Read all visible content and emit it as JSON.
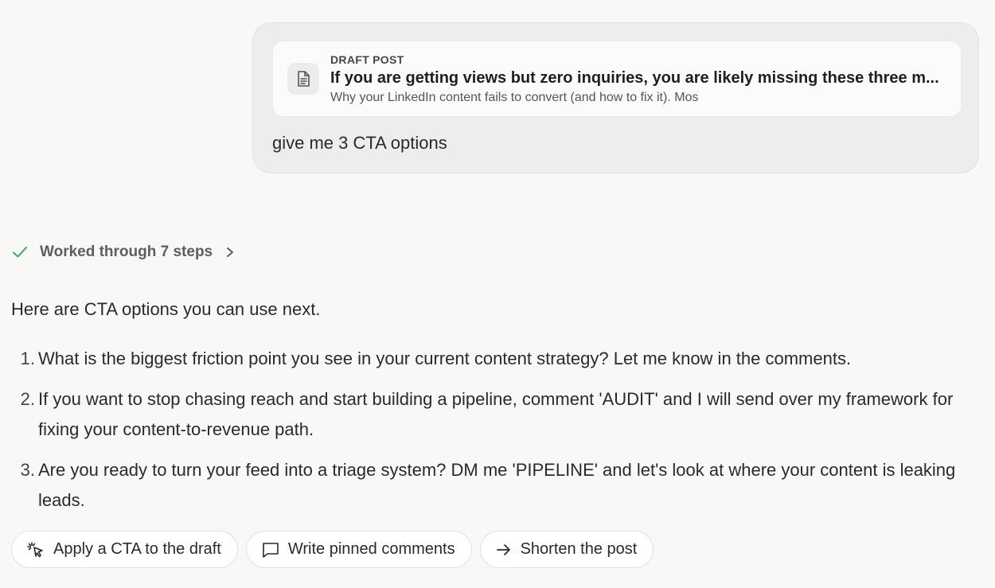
{
  "user_message": {
    "attachment": {
      "kicker": "DRAFT POST",
      "title": "If you are getting views but zero inquiries, you are likely missing these three m...",
      "subtitle": "Why your LinkedIn content fails to convert (and how to fix it). Mos",
      "icon": "document-icon"
    },
    "text": "give me 3 CTA options"
  },
  "steps": {
    "label": "Worked through 7 steps",
    "status_color": "#3aa55c"
  },
  "response": {
    "intro": "Here are CTA options you can use next.",
    "options": [
      {
        "num": "1.",
        "text": "What is the biggest friction point you see in your current content strategy? Let me know in the comments."
      },
      {
        "num": "2.",
        "text": "If you want to stop chasing reach and start building a pipeline, comment 'AUDIT' and I will send over my framework for fixing your content-to-revenue path."
      },
      {
        "num": "3.",
        "text": "Are you ready to turn your feed into a triage system? DM me 'PIPELINE' and let's look at where your content is leaking leads."
      }
    ]
  },
  "actions": [
    {
      "label": "Apply a CTA to the draft",
      "icon": "cursor-click-icon"
    },
    {
      "label": "Write pinned comments",
      "icon": "comment-icon"
    },
    {
      "label": "Shorten the post",
      "icon": "arrow-right-icon"
    }
  ]
}
